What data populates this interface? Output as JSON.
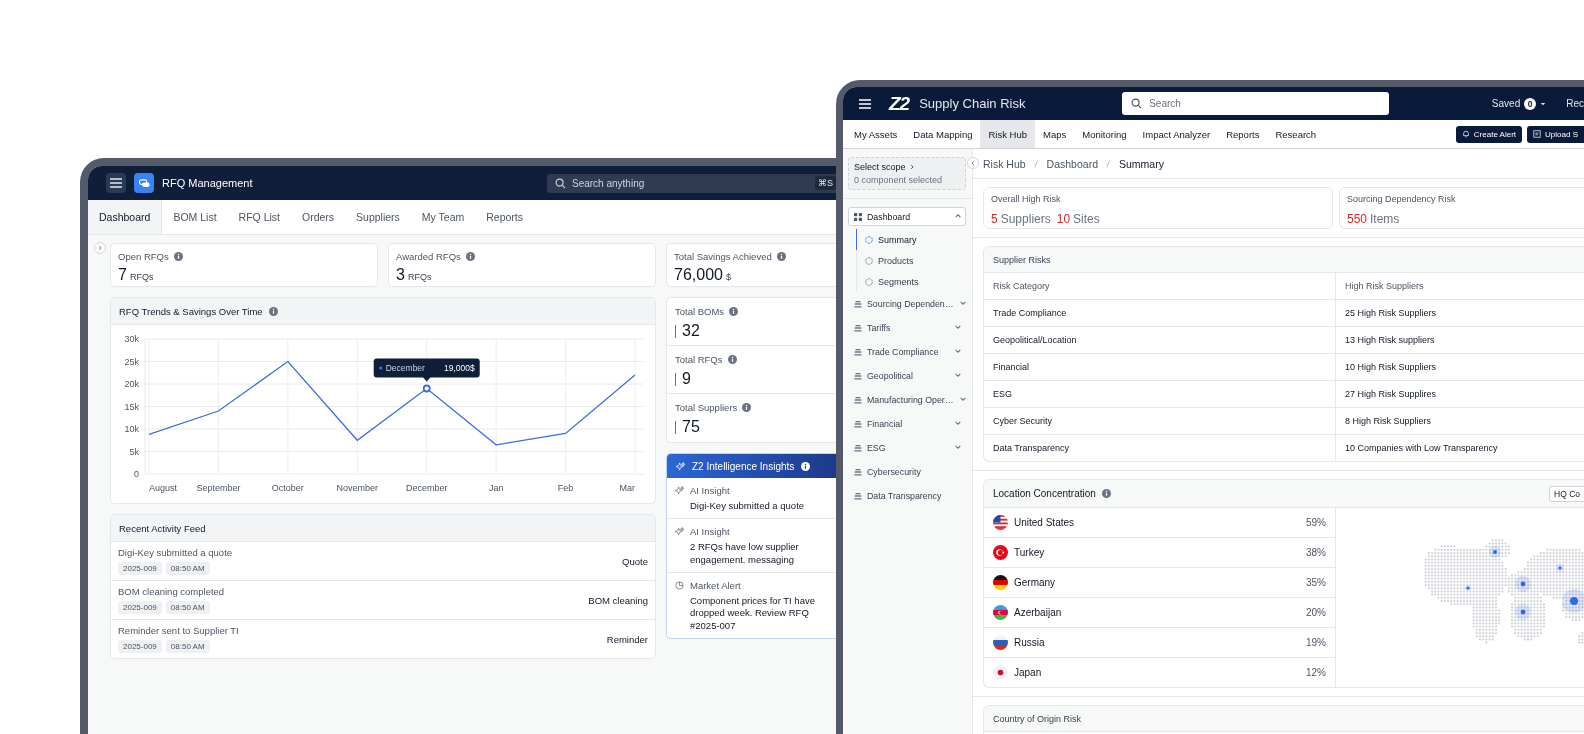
{
  "rfq_window": {
    "header": {
      "title": "RFQ Management",
      "search": {
        "placeholder": "Search anything",
        "shortcut": "⌘S"
      }
    },
    "tabs": [
      {
        "label": "Dashboard",
        "selected": true
      },
      {
        "label": "BOM List",
        "selected": false
      },
      {
        "label": "RFQ List",
        "selected": false
      },
      {
        "label": "Orders",
        "selected": false
      },
      {
        "label": "Suppliers",
        "selected": false
      },
      {
        "label": "My Team",
        "selected": false
      },
      {
        "label": "Reports",
        "selected": false
      }
    ],
    "stats": [
      {
        "label": "Open RFQs",
        "value": "7",
        "unit": "RFQs"
      },
      {
        "label": "Awarded RFQs",
        "value": "3",
        "unit": "RFQs"
      }
    ],
    "savings": {
      "label": "Total Savings Achieved",
      "value": "76,000",
      "unit": "$"
    },
    "chart": {
      "title": "RFQ Trends & Savings Over Time",
      "chart_data": {
        "type": "line",
        "categories": [
          "August",
          "September",
          "October",
          "November",
          "December",
          "Jan",
          "Feb",
          "Mar"
        ],
        "series": [
          {
            "color": "#3b6fe0",
            "values": [
              8800,
              14000,
              25000,
              7500,
              19000,
              6500,
              9000,
              22000
            ]
          }
        ],
        "ylim": [
          0,
          30000
        ],
        "yticks": [
          {
            "value": 0,
            "label": "0"
          },
          {
            "value": 5000,
            "label": "5k"
          },
          {
            "value": 10000,
            "label": "10k"
          },
          {
            "value": 15000,
            "label": "15k"
          },
          {
            "value": 20000,
            "label": "20k"
          },
          {
            "value": 25000,
            "label": "25k"
          },
          {
            "value": 30000,
            "label": "30k"
          }
        ],
        "grid": true
      },
      "points": [
        {
          "selected": false
        },
        {
          "selected": false
        },
        {
          "selected": false
        },
        {
          "selected": false
        },
        {
          "selected": true
        },
        {
          "selected": false
        },
        {
          "selected": false
        },
        {
          "selected": false
        }
      ],
      "tooltip": {
        "label": "December",
        "value": "19,000$"
      }
    },
    "totals": [
      {
        "label": "Total BOMs",
        "value": "32"
      },
      {
        "label": "Total RFQs",
        "value": "9"
      },
      {
        "label": "Total Suppliers",
        "value": "75"
      }
    ],
    "insights": {
      "title": "Z2 Intelligence Insights",
      "items": [
        {
          "kind": "ai",
          "label": "AI Insight",
          "text": "Digi-Key submitted a quote"
        },
        {
          "kind": "ai",
          "label": "AI Insight",
          "text": "2 RFQs have low supplier engagement. messaging"
        },
        {
          "kind": "market",
          "label": "Market Alert",
          "text": "Component prices for TI have dropped week. Review RFQ #2025-007"
        }
      ]
    },
    "activity": {
      "title": "Recent Activity Feed",
      "items": [
        {
          "title": "Digi-Key submitted a quote",
          "date": "2025-009",
          "time": "08:50 AM",
          "type": "Quote"
        },
        {
          "title": "BOM cleaning completed",
          "date": "2025-009",
          "time": "08:50 AM",
          "type": "BOM cleaning"
        },
        {
          "title": "Reminder sent to Supplier TI",
          "date": "2025-009",
          "time": "08:50 AM",
          "type": "Reminder"
        }
      ]
    }
  },
  "risk_window": {
    "header": {
      "logo": "Z2",
      "title": "Supply Chain Risk",
      "search": {
        "placeholder": "Search"
      },
      "saved": {
        "label": "Saved",
        "count": "0"
      },
      "cut_item": "Rec"
    },
    "tabs": [
      {
        "label": "My Assets",
        "selected": false
      },
      {
        "label": "Data Mapping",
        "selected": false
      },
      {
        "label": "Risk Hub",
        "selected": true
      },
      {
        "label": "Maps",
        "selected": false
      },
      {
        "label": "Monitoring",
        "selected": false
      },
      {
        "label": "Impact Analyzer",
        "selected": false
      },
      {
        "label": "Reports",
        "selected": false
      },
      {
        "label": "Research",
        "selected": false
      }
    ],
    "actions": [
      {
        "kind": "alert",
        "label": "Create Alert"
      },
      {
        "kind": "upload",
        "label": "Upload S"
      }
    ],
    "sidebar": {
      "scope": {
        "title": "Select scope",
        "subtitle": "0 component selected"
      },
      "items": [
        {
          "label": "Dashboard",
          "selected": true,
          "expanded": true,
          "children": [
            {
              "label": "Summary",
              "selected": true
            },
            {
              "label": "Products",
              "selected": false
            },
            {
              "label": "Segments",
              "selected": false
            }
          ]
        },
        {
          "label": "Sourcing Dependen…",
          "selected": false,
          "expanded": false
        },
        {
          "label": "Tariffs",
          "selected": false,
          "expanded": false
        },
        {
          "label": "Trade Compliance",
          "selected": false,
          "expanded": false
        },
        {
          "label": "Geopolitical",
          "selected": false,
          "expanded": false
        },
        {
          "label": "Manufacturing Oper…",
          "selected": false,
          "expanded": false
        },
        {
          "label": "Financial",
          "selected": false,
          "expanded": false
        },
        {
          "label": "ESG",
          "selected": false,
          "expanded": false
        },
        {
          "label": "Cybersecurity",
          "selected": false
        },
        {
          "label": "Data Transparency",
          "selected": false
        }
      ]
    },
    "breadcrumb": [
      "Risk Hub",
      "Dashboard",
      "Summary"
    ],
    "summary_cards": [
      {
        "label": "Overall High Risk",
        "values": [
          {
            "value": "5",
            "unit": "Suppliers"
          },
          {
            "value": "10",
            "unit": "Sites"
          }
        ]
      },
      {
        "label": "Sourcing Dependency Risk",
        "values": [
          {
            "value": "550",
            "unit": "Items"
          }
        ]
      }
    ],
    "supplier_risks": {
      "title": "Supplier Risks",
      "columns": [
        "Risk Category",
        "High Risk Suppliers"
      ],
      "rows": [
        [
          "Trade Compliance",
          "25 High Risk Suppliers"
        ],
        [
          "Geopolitical/Location",
          "13 High Risk suppliers"
        ],
        [
          "Financial",
          "10 High Risk Suppliers"
        ],
        [
          "ESG",
          "27 High Risk Supplires"
        ],
        [
          "Cyber Security",
          "8 High Risk Suppliers"
        ],
        [
          "Data Transparency",
          "10 Companies with Low Transparency"
        ]
      ]
    },
    "location": {
      "title": "Location Concentration",
      "filter": "HQ Co",
      "rows": [
        {
          "kind": "us",
          "country": "United States",
          "share": "59%"
        },
        {
          "kind": "tr",
          "country": "Turkey",
          "share": "38%"
        },
        {
          "kind": "de",
          "country": "Germany",
          "share": "35%"
        },
        {
          "kind": "az",
          "country": "Azerbaijan",
          "share": "20%"
        },
        {
          "kind": "ru",
          "country": "Russia",
          "share": "19%"
        },
        {
          "kind": "jp",
          "country": "Japan",
          "share": "12%"
        }
      ]
    },
    "origin": {
      "title": "Country of Origin Risk"
    }
  }
}
